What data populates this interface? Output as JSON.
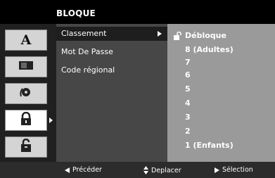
{
  "menu": {
    "title": "BLOQUE",
    "icons": [
      {
        "name": "language-icon",
        "glyph": "A",
        "selected": false
      },
      {
        "name": "display-icon",
        "selected": false
      },
      {
        "name": "audio-icon",
        "selected": false
      },
      {
        "name": "lock-icon",
        "selected": true
      },
      {
        "name": "others-icon",
        "selected": false
      }
    ],
    "items": [
      {
        "label": "Classement",
        "active": true
      },
      {
        "label": "Mot De Passe",
        "active": false
      },
      {
        "label": "Code régional",
        "active": false
      }
    ],
    "options": [
      "Débloque",
      "8 (Adultes)",
      "7",
      "6",
      "5",
      "4",
      "3",
      "2",
      "1 (Enfants)"
    ],
    "help": {
      "prev": "Précéder",
      "move": "Deplacer",
      "select": "Sélection"
    },
    "colors": {
      "icon_panel": "#202020",
      "menu_panel": "#474747",
      "options_panel": "#9a9a9a",
      "help_bar": "#2c2c2c"
    }
  }
}
